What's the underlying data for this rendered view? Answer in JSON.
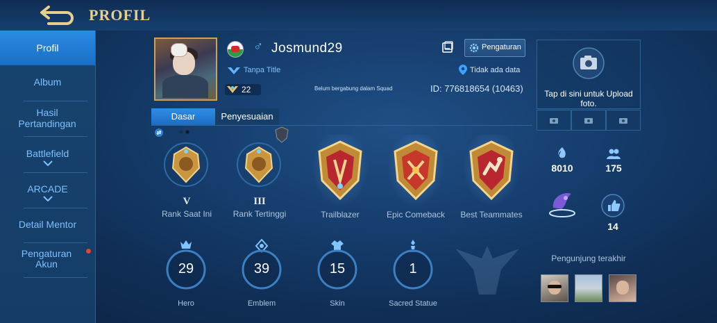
{
  "header": {
    "title": "PROFIL"
  },
  "sidebar": {
    "items": [
      {
        "label": "Profil",
        "active": true
      },
      {
        "label": "Album"
      },
      {
        "label": "Hasil Pertandingan"
      },
      {
        "label": "Battlefield"
      },
      {
        "label": "ARCADE"
      },
      {
        "label": "Detail Mentor"
      },
      {
        "label": "Pengaturan Akun"
      }
    ]
  },
  "profile": {
    "name": "Josmund29",
    "gender_symbol": "♂",
    "title": "Tanpa Title",
    "level": "22",
    "squad": "Belum bergabung dalam Squad",
    "id": "ID: 776818654 (10463)",
    "location": "Tidak ada data",
    "settings_label": "Pengaturan"
  },
  "tabs": [
    {
      "label": "Dasar",
      "active": true
    },
    {
      "label": "Penyesuaian"
    }
  ],
  "ranks": [
    {
      "tier": "V",
      "label": "Rank Saat Ini"
    },
    {
      "tier": "III",
      "label": "Rank Tertinggi"
    }
  ],
  "medals": [
    {
      "label": "Trailblazer"
    },
    {
      "label": "Epic Comeback"
    },
    {
      "label": "Best Teammates"
    }
  ],
  "stats": [
    {
      "value": "29",
      "label": "Hero"
    },
    {
      "value": "39",
      "label": "Emblem"
    },
    {
      "value": "15",
      "label": "Skin"
    },
    {
      "value": "1",
      "label": "Sacred Statue"
    }
  ],
  "right_panel": {
    "upload_text": "Tap di sini untuk Upload foto.",
    "popularity": "8010",
    "followers": "175",
    "likes": "14",
    "visitors_label": "Pengunjung terakhir"
  },
  "colors": {
    "accent": "#2f8de6",
    "gold": "#e9cf8e",
    "link": "#7fc0ff"
  }
}
